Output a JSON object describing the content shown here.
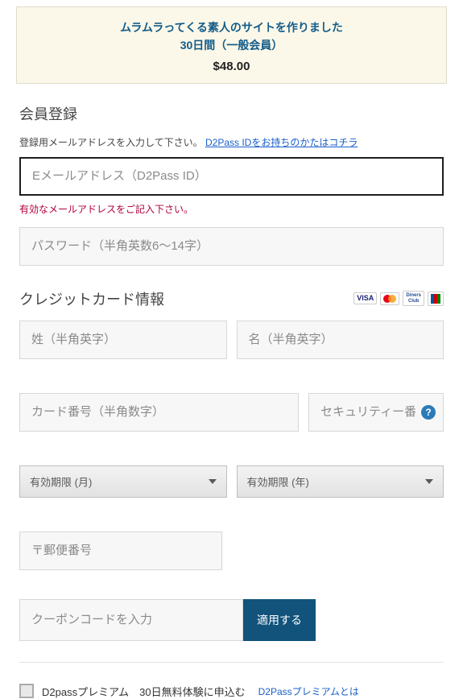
{
  "banner": {
    "title_line1": "ムラムラってくる素人のサイトを作りました",
    "title_line2": "30日間（一般会員）",
    "price": "$48.00"
  },
  "register": {
    "heading": "会員登録",
    "helper_text": "登録用メールアドレスを入力して下さい。",
    "helper_link": "D2Pass IDをお持ちのかたはコチラ",
    "email_placeholder": "Eメールアドレス（D2Pass ID）",
    "email_error": "有効なメールアドレスをご記入下さい。",
    "password_placeholder": "パスワード（半角英数6～14字）"
  },
  "cc": {
    "heading": "クレジットカード情報",
    "last_placeholder": "姓（半角英字）",
    "first_placeholder": "名（半角英字）",
    "card_placeholder": "カード番号（半角数字）",
    "sec_placeholder": "セキュリティー番号",
    "help_badge": "?",
    "exp_month_label": "有効期限 (月)",
    "exp_year_label": "有効期限 (年)",
    "zip_placeholder": "〒郵便番号"
  },
  "coupon": {
    "placeholder": "クーポンコードを入力",
    "button": "適用する"
  },
  "premium": {
    "label": "D2passプレミアム　30日無料体験に申込む",
    "link": "D2Passプレミアムとは"
  },
  "icons": {
    "visa": "VISA"
  }
}
